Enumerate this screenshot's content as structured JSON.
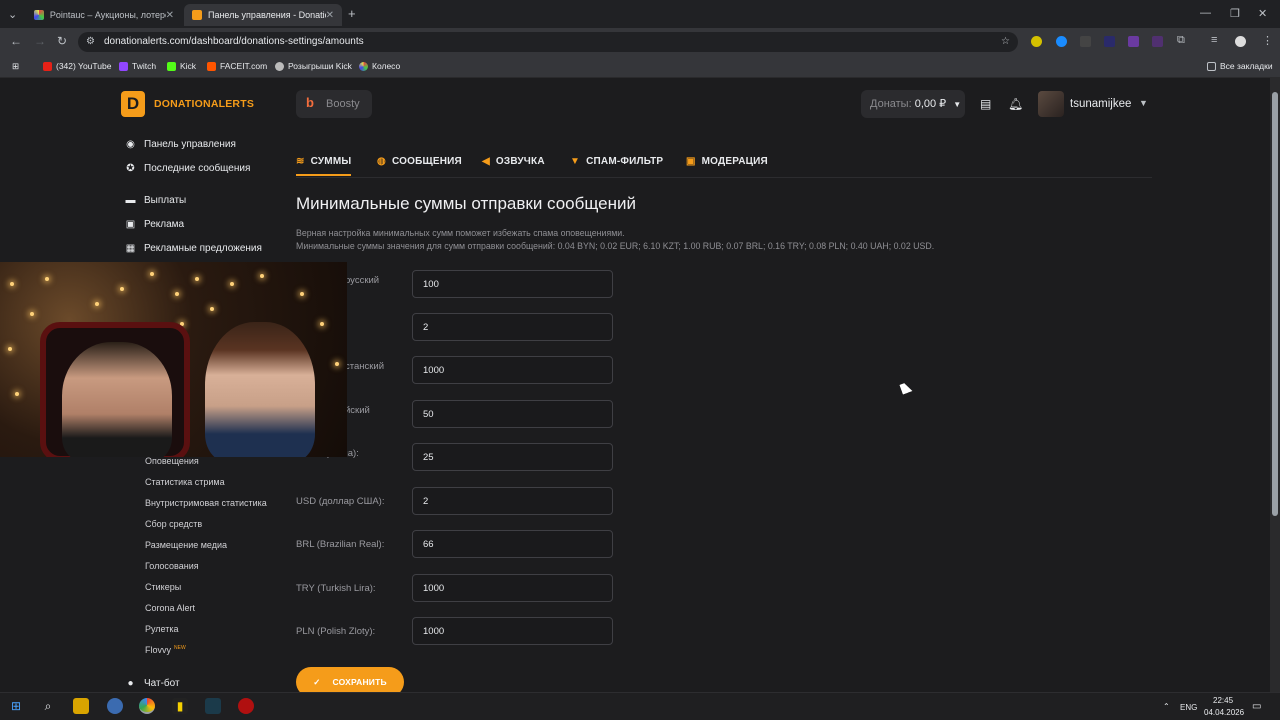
{
  "browser": {
    "tabs": [
      {
        "title": "Pointauc – Аукционы, лотереи",
        "active": false
      },
      {
        "title": "Панель управления - Donatio",
        "active": true
      }
    ],
    "new_tab": "+",
    "url": "donationalerts.com/dashboard/donations-settings/amounts",
    "bookmarks": [
      "(342) YouTube",
      "Twitch",
      "Kick",
      "FACEIT.com",
      "Розыгрыши Kick",
      "Колесо"
    ],
    "all_bookmarks": "Все закладки"
  },
  "header": {
    "logo_text": "DONATIONALERTS",
    "boosty": "Boosty",
    "donations_label": "Донаты:",
    "donations_value": "0,00 ₽",
    "username": "tsunamijkee"
  },
  "sidebar": {
    "main_items": [
      {
        "label": "Панель управления",
        "icon": "palette-icon"
      },
      {
        "label": "Последние сообщения",
        "icon": "star-icon"
      },
      {
        "label": "Выплаты",
        "icon": "wallet-icon"
      },
      {
        "label": "Реклама",
        "icon": "ad-icon"
      },
      {
        "label": "Рекламные предложения",
        "icon": "briefcase-icon"
      }
    ],
    "sub_items": [
      "Оповещения",
      "Статистика стрима",
      "Внутристримовая статистика",
      "Сбор средств",
      "Размещение медиа",
      "Голосования",
      "Стикеры",
      "Corona Alert",
      "Рулетка",
      "Flovvy"
    ],
    "new_badge": "NEW",
    "chat_bot": "Чат-бот"
  },
  "page_tabs": [
    {
      "label": "СУММЫ",
      "active": true
    },
    {
      "label": "СООБЩЕНИЯ",
      "active": false
    },
    {
      "label": "ОЗВУЧКА",
      "active": false
    },
    {
      "label": "СПАМ-ФИЛЬТР",
      "active": false
    },
    {
      "label": "МОДЕРАЦИЯ",
      "active": false
    }
  ],
  "content": {
    "title": "Минимальные суммы отправки сообщений",
    "desc1": "Верная настройка минимальных сумм поможет избежать спама оповещениями.",
    "desc2": "Минимальные суммы значения для сумм отправки сообщений: 0.04 BYN; 0.02 EUR; 6.10 KZT; 1.00 RUB; 0.07 BRL; 0.16 TRY; 0.08 PLN; 0.40 UAH; 0.02 USD.",
    "fields": [
      {
        "label": "русский",
        "value": "100"
      },
      {
        "label": "",
        "value": "2"
      },
      {
        "label": "станский",
        "value": "1000"
      },
      {
        "label": "йский",
        "value": "50"
      },
      {
        "label": "нская гривна):",
        "value": "25"
      },
      {
        "label": "USD (доллар США):",
        "value": "2"
      },
      {
        "label": "BRL (Brazilian Real):",
        "value": "66"
      },
      {
        "label": "TRY (Turkish Lira):",
        "value": "1000"
      },
      {
        "label": "PLN (Polish Zloty):",
        "value": "1000"
      }
    ],
    "save_button": "СОХРАНИТЬ"
  },
  "taskbar": {
    "lang": "ENG",
    "time": "22:45",
    "date": "04.04.2026"
  },
  "colors": {
    "accent": "#f59c1a",
    "background": "#1c1c1e"
  }
}
